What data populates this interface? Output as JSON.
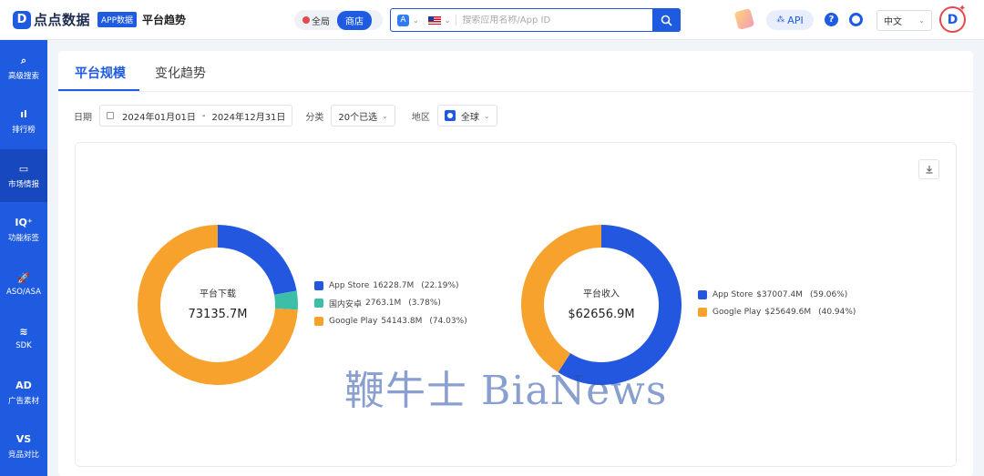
{
  "header": {
    "logo_text": "点点数据",
    "badge": "APP数据",
    "page_title": "平台趋势",
    "scope_global": "全局",
    "scope_store": "商店",
    "search_placeholder": "搜索应用名称/App ID",
    "api_label": "API",
    "help_label": "?",
    "language": "中文"
  },
  "sidebar": {
    "items": [
      {
        "label": "高级搜索",
        "icon": "search-icon",
        "glyph": "⌕"
      },
      {
        "label": "排行榜",
        "icon": "bar-chart-icon",
        "glyph": "ıl"
      },
      {
        "label": "市场情报",
        "icon": "monitor-icon",
        "glyph": "▭"
      },
      {
        "label": "功能标签",
        "icon": "iq-icon",
        "glyph": "IQ⁺"
      },
      {
        "label": "ASO/ASA",
        "icon": "rocket-icon",
        "glyph": "🚀"
      },
      {
        "label": "SDK",
        "icon": "layers-icon",
        "glyph": "≋"
      },
      {
        "label": "广告素材",
        "icon": "ad-icon",
        "glyph": "AD"
      },
      {
        "label": "竞品对比",
        "icon": "vs-icon",
        "glyph": "VS"
      }
    ],
    "active_index": 2
  },
  "tabs": [
    {
      "label": "平台规模"
    },
    {
      "label": "变化趋势"
    }
  ],
  "filters": {
    "date_label": "日期",
    "date_start": "2024年01月01日",
    "date_sep": "-",
    "date_end": "2024年12月31日",
    "category_label": "分类",
    "category_value": "20个已选",
    "region_label": "地区",
    "region_value": "全球"
  },
  "colors": {
    "app_store": "#2457e0",
    "china_android": "#3dbfa7",
    "google_play": "#f8a22e"
  },
  "chart_data": [
    {
      "type": "pie",
      "title": "平台下载",
      "total": "73135.7M",
      "slices": [
        {
          "name": "App Store",
          "value_label": "16228.7M",
          "value": 16228.7,
          "percent": 22.19,
          "pct_label": "(22.19%)"
        },
        {
          "name": "国内安卓",
          "value_label": "2763.1M",
          "value": 2763.1,
          "percent": 3.78,
          "pct_label": "(3.78%)"
        },
        {
          "name": "Google Play",
          "value_label": "54143.8M",
          "value": 54143.8,
          "percent": 74.03,
          "pct_label": "(74.03%)"
        }
      ]
    },
    {
      "type": "pie",
      "title": "平台收入",
      "total": "$62656.9M",
      "slices": [
        {
          "name": "App Store",
          "value_label": "$37007.4M",
          "value": 37007.4,
          "percent": 59.06,
          "pct_label": "(59.06%)"
        },
        {
          "name": "Google Play",
          "value_label": "$25649.6M",
          "value": 25649.6,
          "percent": 40.94,
          "pct_label": "(40.94%)"
        }
      ]
    }
  ],
  "watermark": "鞭牛士 BiaNews"
}
